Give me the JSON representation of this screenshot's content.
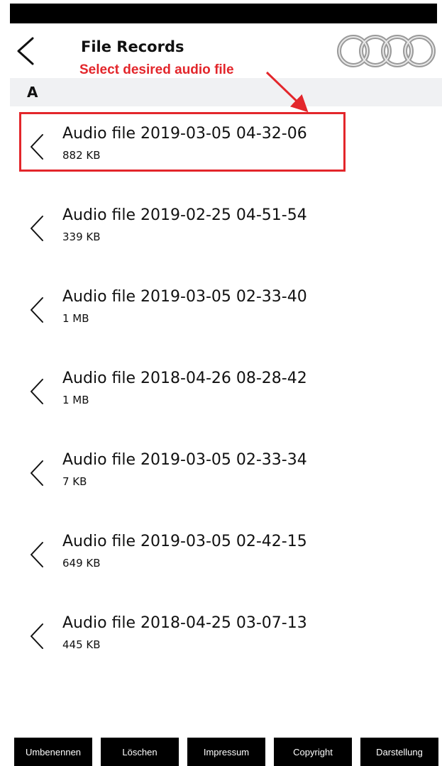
{
  "header": {
    "title": "File Records",
    "back_icon": "chevron-left-icon",
    "logo": "four-rings-logo"
  },
  "annotation": {
    "text": "Select desired audio file",
    "color": "#e3262b"
  },
  "section": {
    "letter": "A"
  },
  "files": [
    {
      "name": "Audio file 2019-03-05 04-32-06",
      "size": "882 KB",
      "highlighted": true
    },
    {
      "name": "Audio file 2019-02-25 04-51-54",
      "size": "339 KB",
      "highlighted": false
    },
    {
      "name": "Audio file 2019-03-05 02-33-40",
      "size": "1 MB",
      "highlighted": false
    },
    {
      "name": "Audio file 2018-04-26 08-28-42",
      "size": "1 MB",
      "highlighted": false
    },
    {
      "name": "Audio file 2019-03-05 02-33-34",
      "size": "7 KB",
      "highlighted": false
    },
    {
      "name": "Audio file 2019-03-05 02-42-15",
      "size": "649 KB",
      "highlighted": false
    },
    {
      "name": "Audio file 2018-04-25 03-07-13",
      "size": "445 KB",
      "highlighted": false
    }
  ],
  "toolbar": {
    "rename_label": "Umbenennen",
    "delete_label": "Löschen",
    "imprint_label": "Impressum",
    "copyright_label": "Copyright",
    "display_label": "Darstellung"
  },
  "colors": {
    "accent_red": "#e3262b",
    "toolbar_bg": "#000000",
    "section_bg": "#f0f1f3"
  }
}
